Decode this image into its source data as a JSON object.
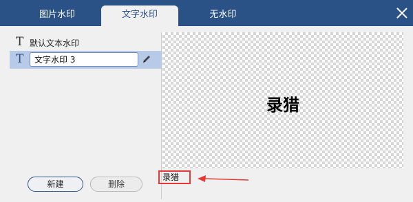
{
  "tabs": [
    {
      "label": "图片水印",
      "active": false
    },
    {
      "label": "文字水印",
      "active": true
    },
    {
      "label": "无水印",
      "active": false
    }
  ],
  "watermarks": {
    "items": [
      {
        "icon": "T",
        "label": "默认文本水印"
      },
      {
        "icon": "T",
        "value": "文字水印 3"
      }
    ]
  },
  "buttons": {
    "new_label": "新建",
    "delete_label": "删除"
  },
  "preview": {
    "text": "录猎"
  },
  "bottom": {
    "text": "录猎"
  },
  "colors": {
    "titlebar": "#2b5286",
    "selected_row": "#b7cae7",
    "highlight": "#e53935"
  },
  "icons": [
    "close-icon",
    "text-t-icon",
    "pencil-icon",
    "arrow-icon"
  ]
}
